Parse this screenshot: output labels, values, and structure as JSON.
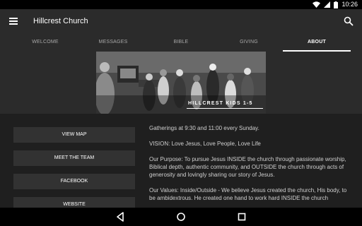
{
  "status": {
    "time": "10:26"
  },
  "app": {
    "title": "Hillcrest Church"
  },
  "tabs": [
    {
      "label": "WELCOME"
    },
    {
      "label": "MESSAGES"
    },
    {
      "label": "BIBLE"
    },
    {
      "label": "GIVING"
    },
    {
      "label": "ABOUT"
    }
  ],
  "active_tab": "ABOUT",
  "hero": {
    "caption": "HILLCREST KIDS 1-5"
  },
  "buttons": {
    "view_map": "VIEW MAP",
    "meet_team": "MEET THE TEAM",
    "facebook": "FACEBOOK",
    "website": "WEBSITE"
  },
  "about": {
    "gatherings": "Gatherings at 9:30 and 11:00 every Sunday.",
    "vision": "VISION: Love Jesus, Love People, Love Life",
    "purpose": "Our Purpose:  To pursue Jesus INSIDE the church through passionate worship, Biblical depth, authentic community, and OUTSIDE the church through acts of generosity and lovingly sharing our story of Jesus.",
    "values": "Our Values: Inside/Outside - We believe Jesus created the church, His body, to be ambidextrous.  He created one hand to work hard INSIDE the church"
  },
  "colors": {
    "background": "#1f1f1f",
    "appbar": "#2b2b2b",
    "button": "#323232",
    "indicator": "#ffffff"
  }
}
